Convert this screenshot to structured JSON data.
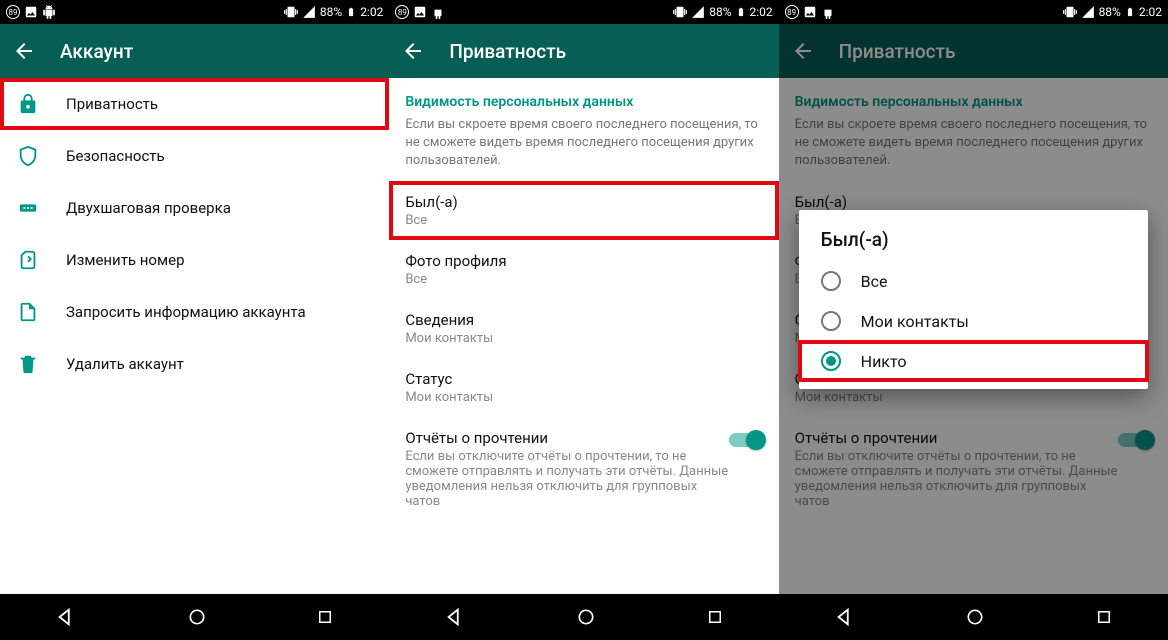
{
  "status": {
    "badge": "89",
    "percent": "88%",
    "time": "2:02"
  },
  "s1": {
    "title": "Аккаунт",
    "items": [
      {
        "label": "Приватность"
      },
      {
        "label": "Безопасность"
      },
      {
        "label": "Двухшаговая проверка"
      },
      {
        "label": "Изменить номер"
      },
      {
        "label": "Запросить информацию аккаунта"
      },
      {
        "label": "Удалить аккаунт"
      }
    ]
  },
  "s2": {
    "title": "Приватность",
    "section": "Видимость персональных данных",
    "help": "Если вы скроете время своего последнего посещения, то не сможете видеть время последнего посещения других пользователей.",
    "prefs": {
      "lastseen": {
        "title": "Был(-а)",
        "sub": "Все"
      },
      "photo": {
        "title": "Фото профиля",
        "sub": "Все"
      },
      "about": {
        "title": "Сведения",
        "sub": "Мои контакты"
      },
      "status": {
        "title": "Статус",
        "sub": "Мои контакты"
      },
      "read": {
        "title": "Отчёты о прочтении",
        "sub": "Если вы отключите отчёты о прочтении, то не сможете отправлять и получать эти отчёты. Данные уведомления нельзя отключить для групповых чатов"
      }
    }
  },
  "s3": {
    "dialog_title": "Был(-а)",
    "options": [
      {
        "label": "Все"
      },
      {
        "label": "Мои контакты"
      },
      {
        "label": "Никто"
      }
    ]
  }
}
